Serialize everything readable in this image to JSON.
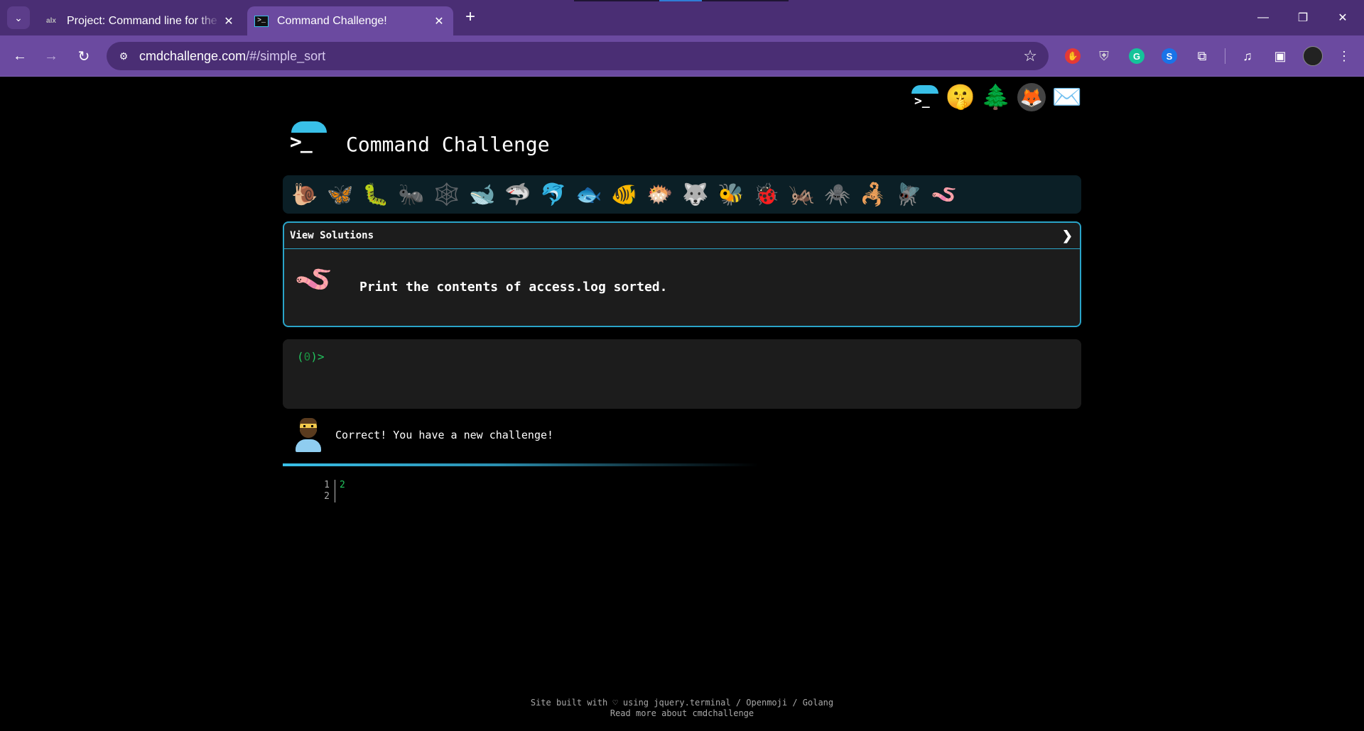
{
  "browser": {
    "tabs": [
      {
        "favicon": "alx",
        "title": "Project: Command line for the w",
        "close": "✕"
      },
      {
        "favicon": ">_",
        "title": "Command Challenge!",
        "close": "✕"
      }
    ],
    "new_tab": "+",
    "tab_menu_icon": "chevron-down-icon",
    "window_controls": {
      "minimize": "—",
      "restore": "❐",
      "close": "✕"
    },
    "address": {
      "domain": "cmdchallenge.com",
      "path": "/#/simple_sort"
    },
    "nav": {
      "back": "←",
      "forward": "→",
      "reload": "↻"
    },
    "star": "☆"
  },
  "top_links": {
    "terminal": ">_",
    "shh": "🤫",
    "tree": "🌲",
    "gitlab": "🦊",
    "mail": "✉️"
  },
  "site": {
    "logo": ">_",
    "title": "Command Challenge"
  },
  "animals": [
    "🐌",
    "🦋",
    "🐛",
    "🐜",
    "🕸️",
    "🐋",
    "🦈",
    "🐬",
    "🐟",
    "🐠",
    "🐡",
    "🐺",
    "🐝",
    "🐞",
    "🦗",
    "🕷️",
    "🦂",
    "🪰",
    "🪱"
  ],
  "challenge": {
    "header": "View Solutions",
    "chevron": "❯",
    "icon": "🪱",
    "text": "Print the contents of access.log sorted."
  },
  "terminal": {
    "prompt_open": "(",
    "prompt_num": "0",
    "prompt_close": ")>"
  },
  "feedback": {
    "message": "Correct! You have a new challenge!"
  },
  "output": {
    "line_numbers": "1\n2",
    "lines": "2\n"
  },
  "footer": {
    "line1": "Site built with ♡ using jquery.terminal / Openmoji / Golang",
    "line2": "Read more about cmdchallenge"
  },
  "colors": {
    "accent": "#39c0e8",
    "prompt_green": "#22c55e",
    "browser_frame": "#4a2e74",
    "toolbar": "#6b4aa0"
  }
}
